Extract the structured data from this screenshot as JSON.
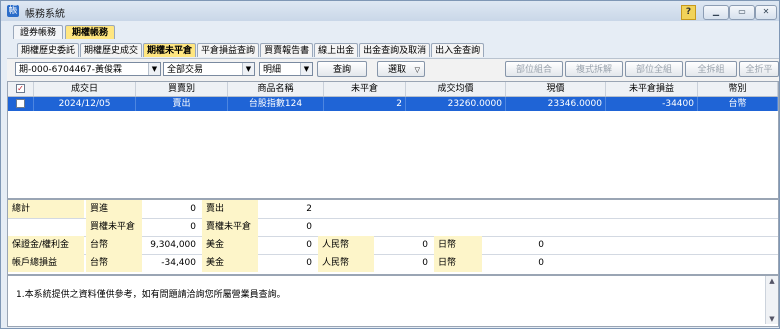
{
  "window": {
    "title": "帳務系統",
    "help": "?",
    "min": "▁",
    "restore": "▭",
    "close": "✕"
  },
  "tabs1": [
    "證券帳務",
    "期權帳務"
  ],
  "tabs2": [
    "期權歷史委託",
    "期權歷史成交",
    "期權未平倉",
    "平倉損益查詢",
    "買賣報告書",
    "線上出金",
    "出金查詢及取消",
    "出入金查詢"
  ],
  "toolbar": {
    "account": "期-000-6704467-黃俊霖",
    "filter": "全部交易",
    "detail": "明細",
    "query": "查詢",
    "select": "選取",
    "buttons": [
      "部位組合",
      "複式拆解",
      "部位全組",
      "全拆組",
      "全折平"
    ]
  },
  "grid": {
    "headers": [
      "成交日",
      "買賣別",
      "商品名稱",
      "未平倉",
      "成交均價",
      "現價",
      "未平倉損益",
      "幣別"
    ],
    "rows": [
      {
        "date": "2024/12/05",
        "side": "賣出",
        "product": "台股指數124",
        "open": "2",
        "avg": "23260.0000",
        "price": "23346.0000",
        "pnl": "-34400",
        "currency": "台幣"
      }
    ]
  },
  "summary": {
    "r1": [
      "總計",
      "買進",
      "0",
      "賣出",
      "2"
    ],
    "r2": [
      "",
      "買權未平倉",
      "0",
      "賣權未平倉",
      "0"
    ],
    "r3": [
      "保證金/權利金",
      "台幣",
      "9,304,000",
      "美金",
      "0",
      "人民幣",
      "0",
      "日幣",
      "0"
    ],
    "r4": [
      "帳戶總損益",
      "台幣",
      "-34,400",
      "美金",
      "0",
      "人民幣",
      "0",
      "日幣",
      "0"
    ]
  },
  "note": "1.本系統提供之資料僅供參考，如有問題請洽詢您所屬營業員查詢。",
  "colors": {
    "selection": "#1f64d6",
    "active_tab": "#ffe680",
    "summary_label": "#fdf5c9"
  }
}
